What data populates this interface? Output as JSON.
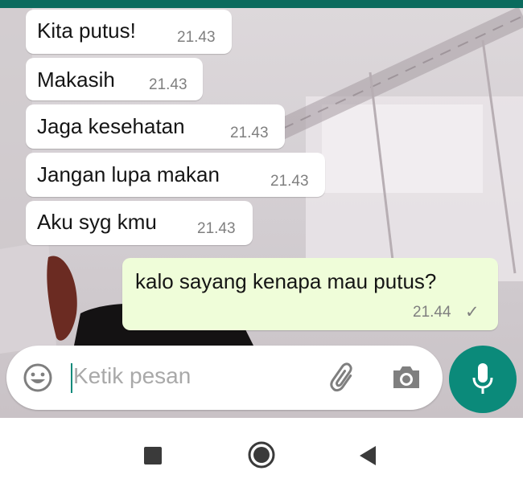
{
  "chat": {
    "messages": [
      {
        "direction": "incoming",
        "text": "Kita putus!",
        "time": "21.43"
      },
      {
        "direction": "incoming",
        "text": "Makasih",
        "time": "21.43"
      },
      {
        "direction": "incoming",
        "text": "Jaga kesehatan",
        "time": "21.43"
      },
      {
        "direction": "incoming",
        "text": "Jangan lupa makan",
        "time": "21.43"
      },
      {
        "direction": "incoming",
        "text": "Aku syg kmu",
        "time": "21.43"
      },
      {
        "direction": "outgoing",
        "text": "kalo sayang kenapa mau putus?",
        "time": "21.44",
        "status": "✓"
      }
    ]
  },
  "composer": {
    "placeholder": "Ketik pesan",
    "icons": [
      "emoji-icon",
      "attach-icon",
      "camera-icon",
      "mic-icon"
    ]
  },
  "navbar": {
    "icons": [
      "recents-icon",
      "home-icon",
      "back-icon"
    ]
  },
  "colors": {
    "header": "#0b6b5e",
    "accent": "#0b8a7a",
    "incoming_bubble": "#ffffff",
    "outgoing_bubble": "#effdd9",
    "timestamp": "#7f7f7f"
  }
}
